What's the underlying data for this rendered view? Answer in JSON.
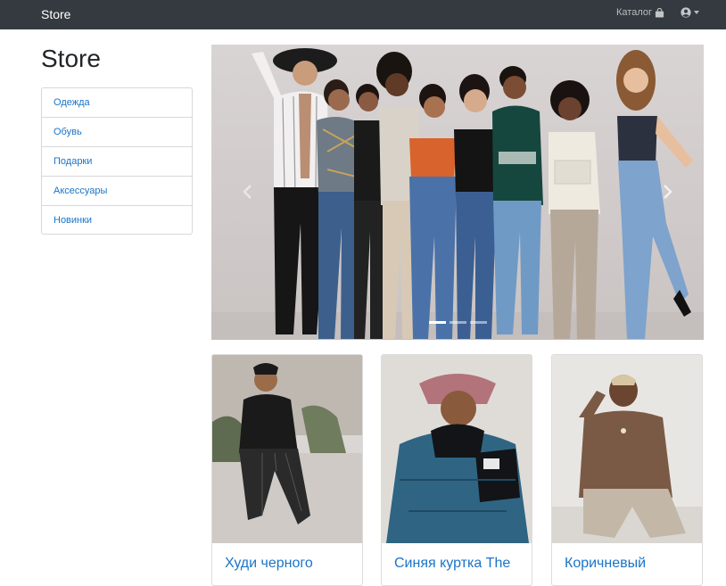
{
  "navbar": {
    "brand": "Store",
    "catalog_label": "Каталог",
    "catalog_icon": "shopping-bag-icon",
    "user_icon": "user-circle-icon"
  },
  "sidebar": {
    "title": "Store",
    "items": [
      {
        "label": "Одежда"
      },
      {
        "label": "Обувь"
      },
      {
        "label": "Подарки"
      },
      {
        "label": "Аксессуары"
      },
      {
        "label": "Новинки"
      }
    ]
  },
  "carousel": {
    "slides": 3,
    "active_slide": 1,
    "prev_icon": "chevron-left-icon",
    "next_icon": "chevron-right-icon"
  },
  "products": [
    {
      "title": "Худи черного"
    },
    {
      "title": "Синяя куртка The"
    },
    {
      "title": "Коричневый"
    }
  ],
  "colors": {
    "navbar_bg": "#343a40",
    "link": "#1a74c8",
    "border": "#d8d8d8"
  }
}
